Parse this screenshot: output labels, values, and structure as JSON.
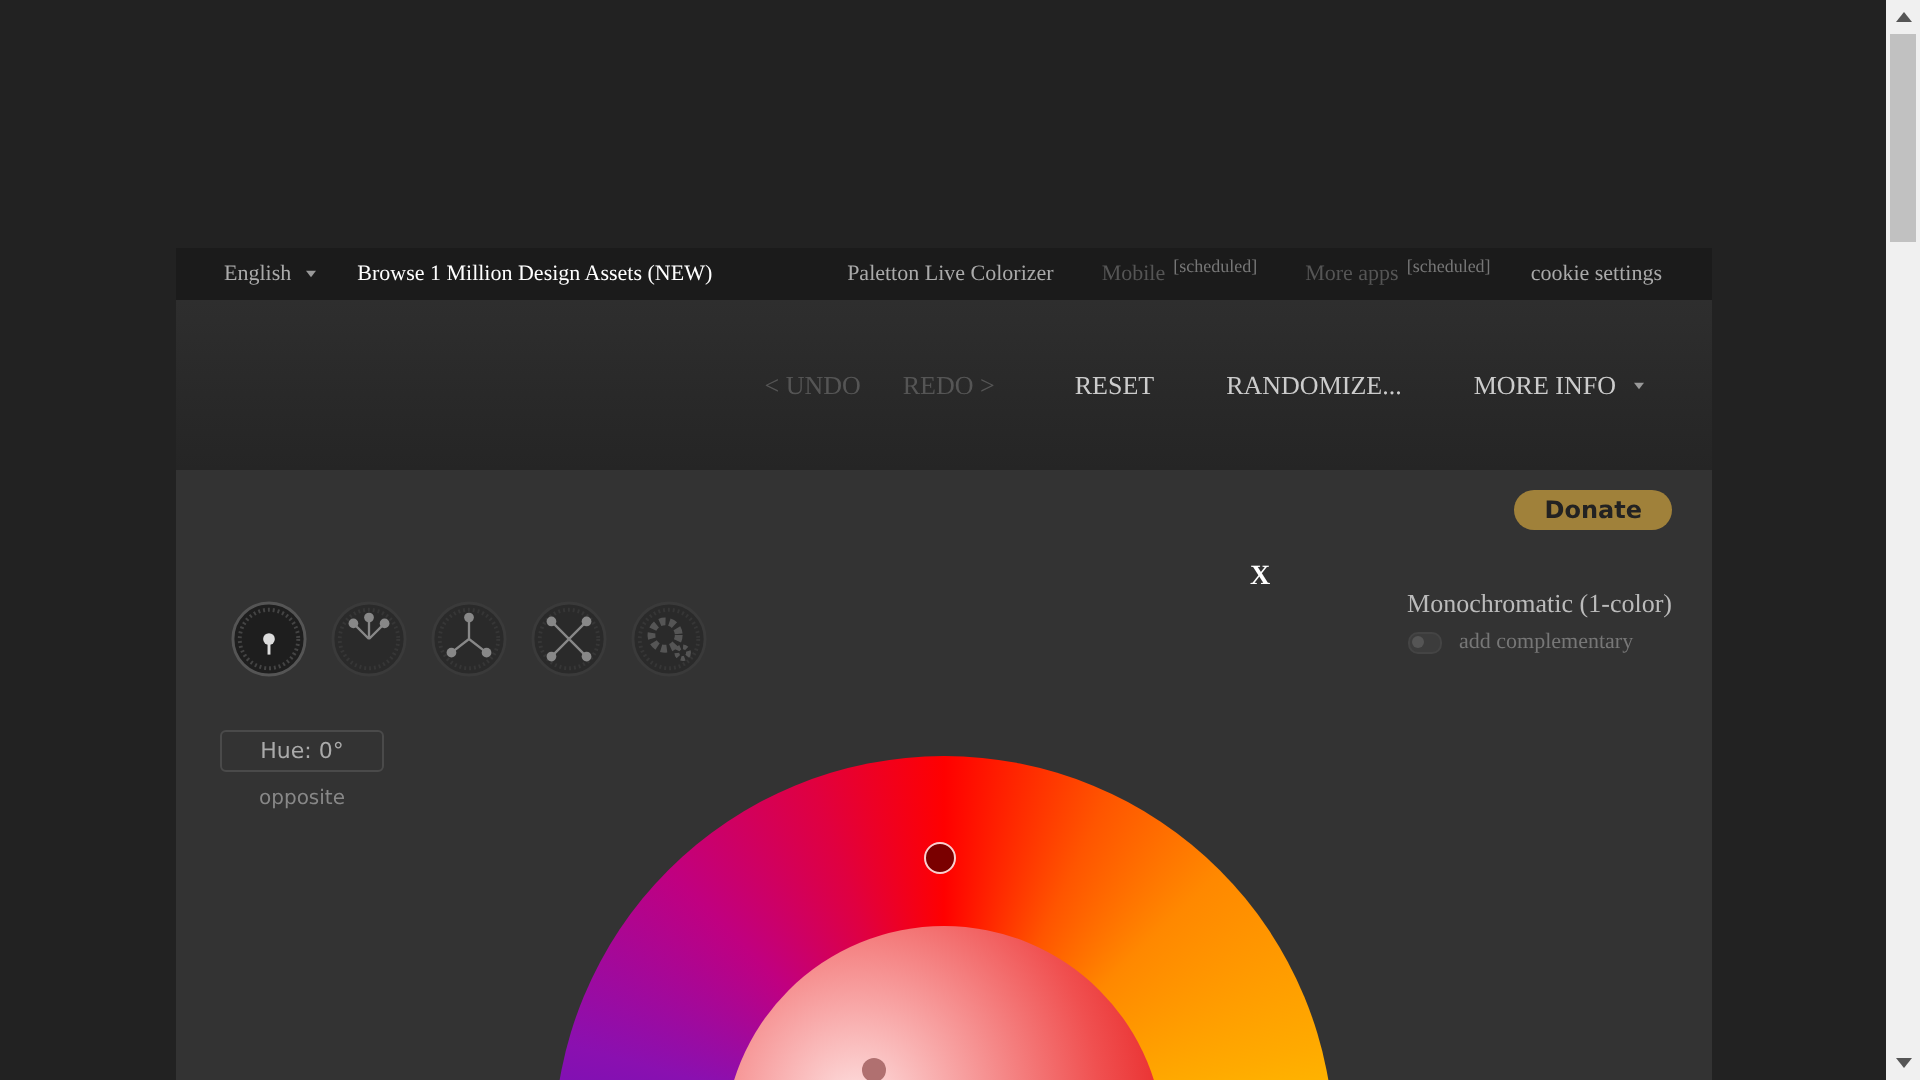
{
  "topbar": {
    "language": "English",
    "links": [
      {
        "label": "Browse 1 Million Design Assets (NEW)",
        "kind": "highlight",
        "disabled": false
      },
      {
        "label": "Paletton Live Colorizer",
        "kind": "normal",
        "disabled": false
      },
      {
        "label": "Mobile",
        "kind": "normal",
        "disabled": true,
        "badge": "[scheduled]"
      },
      {
        "label": "More apps",
        "kind": "normal",
        "disabled": true,
        "badge": "[scheduled]"
      },
      {
        "label": "cookie settings",
        "kind": "normal",
        "disabled": false
      }
    ]
  },
  "toolbar": {
    "buttons": [
      {
        "label": "< UNDO",
        "disabled": true,
        "dropdown": false
      },
      {
        "label": "REDO >",
        "disabled": true,
        "dropdown": false
      },
      {
        "label": "RESET",
        "disabled": false,
        "dropdown": false
      },
      {
        "label": "RANDOMIZE...",
        "disabled": false,
        "dropdown": false
      },
      {
        "label": "MORE INFO",
        "disabled": false,
        "dropdown": true
      }
    ]
  },
  "panel": {
    "donate": "Donate",
    "close": "X",
    "schemes": [
      {
        "kind": "mono",
        "selected": true
      },
      {
        "kind": "adjacent",
        "selected": false
      },
      {
        "kind": "triad",
        "selected": false
      },
      {
        "kind": "tetrad",
        "selected": false
      },
      {
        "kind": "free",
        "selected": false
      }
    ],
    "scheme_title": "Monochromatic (1-color)",
    "complementary": {
      "label": "add complementary",
      "on": false
    },
    "hue": {
      "value": "Hue: 0°",
      "note": "opposite"
    }
  }
}
